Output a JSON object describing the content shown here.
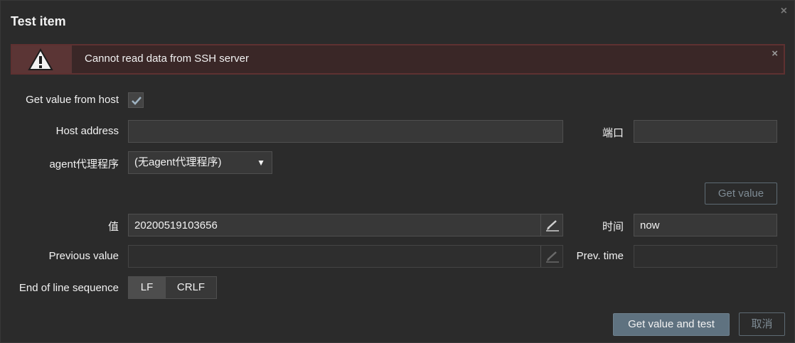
{
  "dialog": {
    "title": "Test item",
    "close_glyph": "×"
  },
  "alert": {
    "icon": "warning-icon",
    "message": "Cannot read data from SSH server",
    "close_glyph": "×"
  },
  "form": {
    "get_value_from_host_label": "Get value from host",
    "get_value_from_host_checked": true,
    "host_address_label": "Host address",
    "host_address_value": "",
    "port_label": "端口",
    "port_value": "",
    "proxy_label": "agent代理程序",
    "proxy_selected": "(无agent代理程序)",
    "get_value_button": "Get value",
    "value_label": "值",
    "value_value": "20200519103656",
    "time_label": "时间",
    "time_value": "now",
    "previous_value_label": "Previous value",
    "previous_value_value": "",
    "prev_time_label": "Prev. time",
    "prev_time_value": "",
    "eol_label": "End of line sequence",
    "eol_options": [
      "LF",
      "CRLF"
    ],
    "eol_selected": "LF"
  },
  "footer": {
    "test_button": "Get value and test",
    "cancel_button": "取消"
  },
  "colors": {
    "background": "#2b2b2b",
    "alert_border": "#5e3131",
    "primary_button": "#5f7280"
  }
}
